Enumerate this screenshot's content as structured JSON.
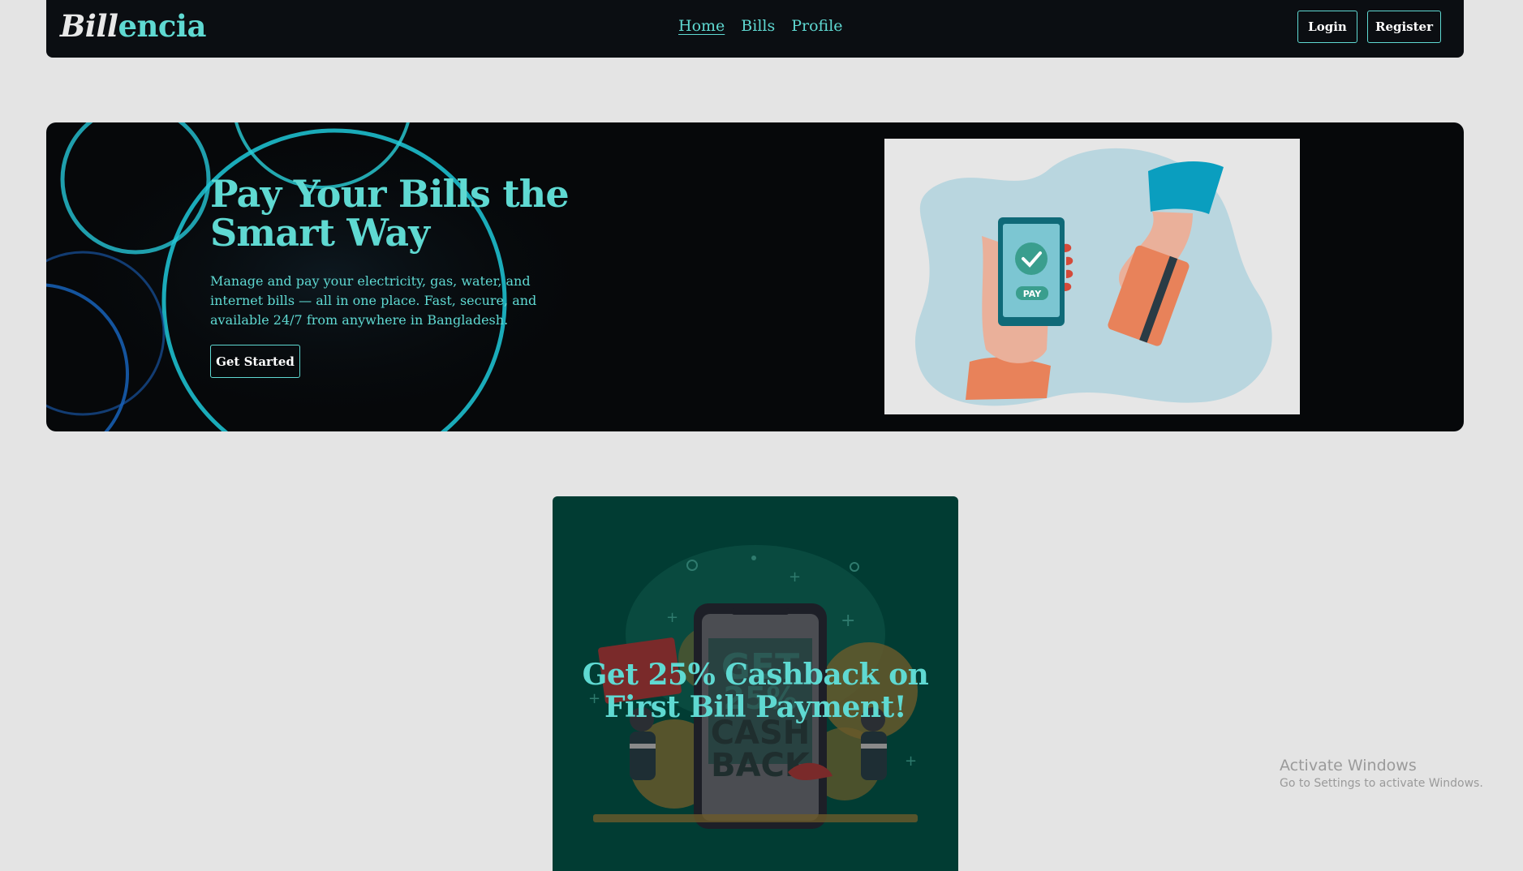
{
  "navbar": {
    "brand_part1": "Bill",
    "brand_part2": "encia",
    "links": [
      {
        "label": "Home",
        "active": true
      },
      {
        "label": "Bills",
        "active": false
      },
      {
        "label": "Profile",
        "active": false
      }
    ],
    "login_label": "Login",
    "register_label": "Register"
  },
  "hero": {
    "title": "Pay Your Bills the Smart Way",
    "description": "Manage and pay your electricity, gas, water, and internet bills — all in one place. Fast, secure, and available 24/7 from anywhere in Bangladesh.",
    "cta_label": "Get Started",
    "illustration": {
      "pay_label": "PAY"
    }
  },
  "promo": {
    "title": "Get 25% Cashback on First Bill Payment!",
    "illustration": {
      "line1": "GET",
      "line2": "25%",
      "line3": "CASH",
      "line4": "BACK"
    }
  },
  "watermark": {
    "title": "Activate Windows",
    "subtitle": "Go to Settings to activate Windows."
  },
  "colors": {
    "accent": "#5fd9d2",
    "nav_bg": "#0b0e12",
    "page_bg": "#e4e4e4",
    "promo_bg": "#013c33"
  }
}
